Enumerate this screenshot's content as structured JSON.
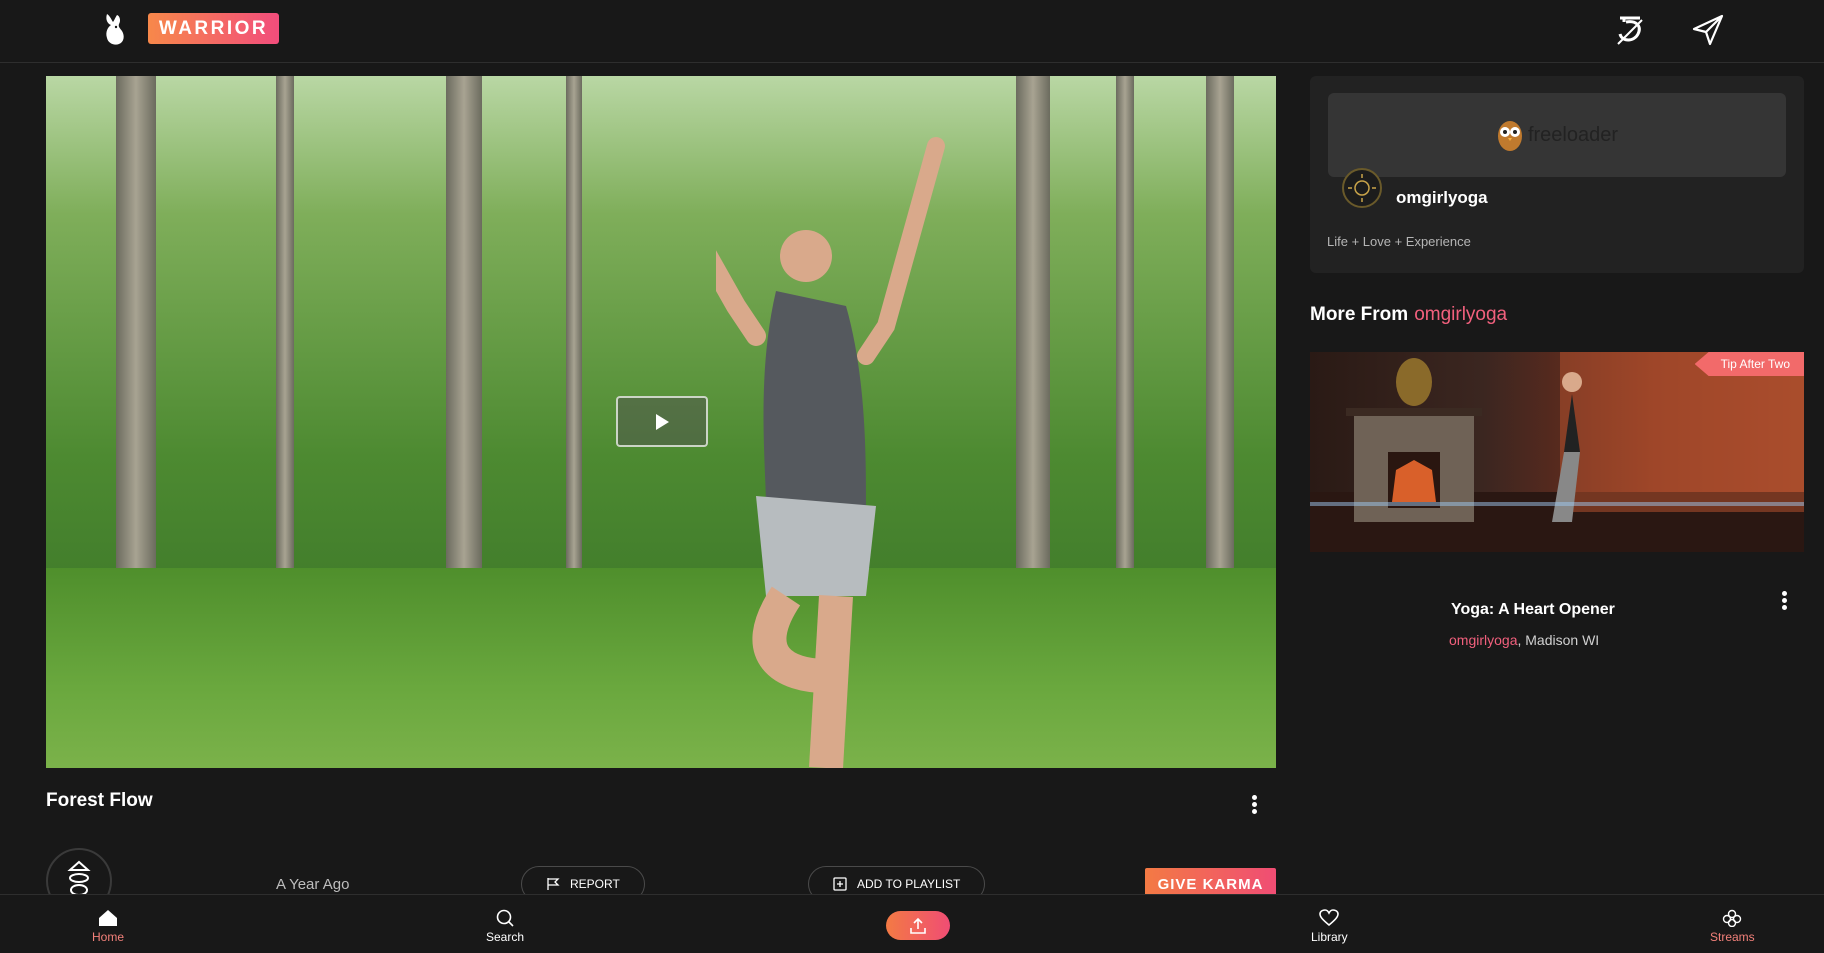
{
  "header": {
    "badge_label": "WARRIOR",
    "logo_icon": "rabbit-logo-icon",
    "karma_icon": "karma-coin-icon",
    "send_icon": "paper-plane-icon"
  },
  "video": {
    "title": "Forest Flow",
    "play_icon": "play-icon",
    "posted": "A Year Ago",
    "report_label": "REPORT",
    "playlist_label": "ADD TO PLAYLIST",
    "karma_label": "GIVE KARMA"
  },
  "channel_card": {
    "sponsor_text": "freeloader",
    "channel_name": "omgirlyoga",
    "description": "Life + Love + Experience"
  },
  "more_from": {
    "prefix": "More From",
    "channel": "omgirlyoga"
  },
  "recommended": [
    {
      "tag": "Tip After Two",
      "title": "Yoga: A Heart Opener",
      "channel": "omgirlyoga",
      "location": ", Madison WI"
    }
  ],
  "bottom_nav": {
    "home": "Home",
    "search": "Search",
    "library": "Library",
    "streams": "Streams"
  },
  "colors": {
    "accent": "#f2607d",
    "gradient_start": "#f7884a",
    "gradient_end": "#f24d7c",
    "background": "#181818"
  }
}
